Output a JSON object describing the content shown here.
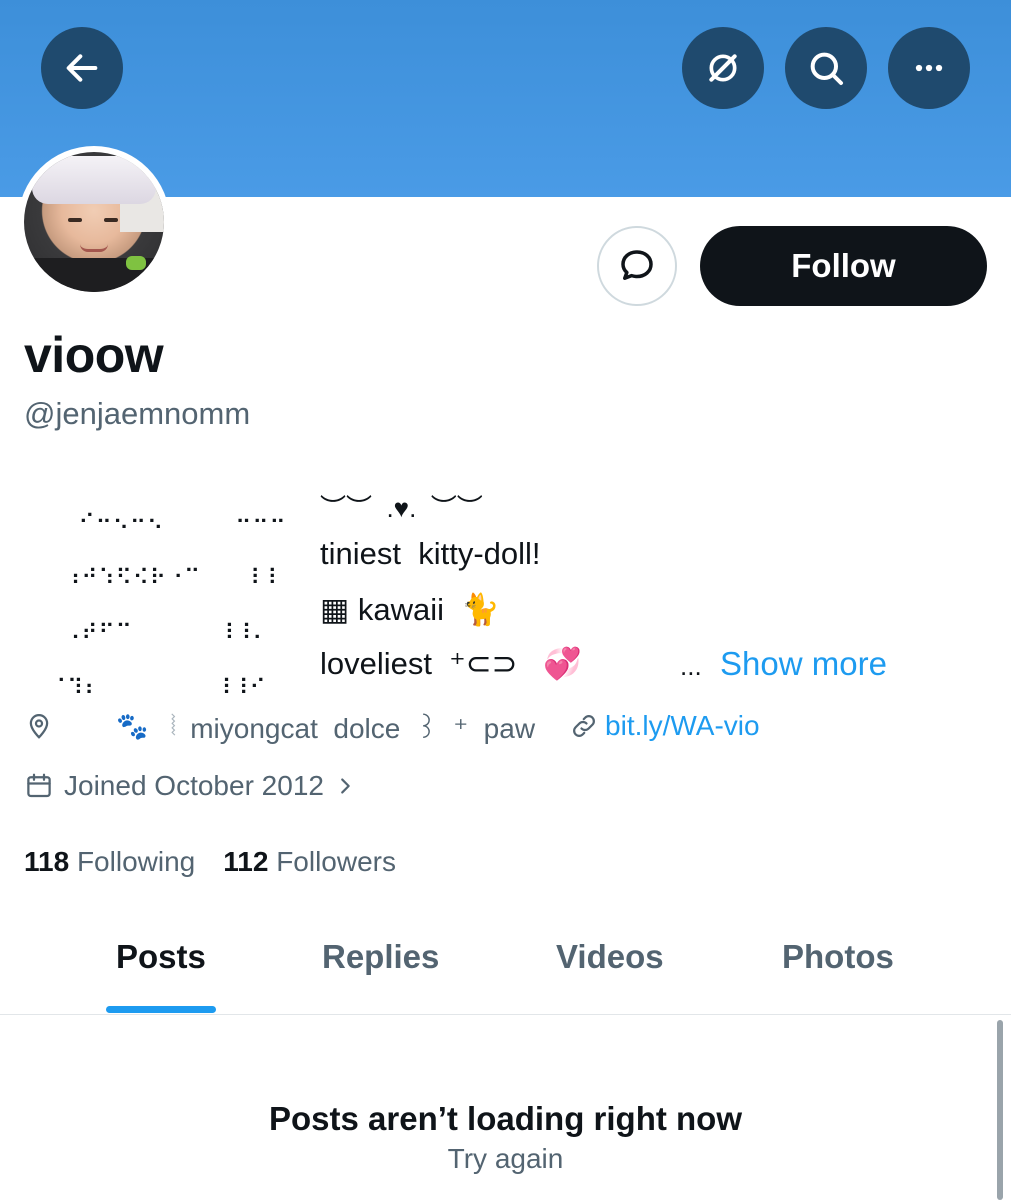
{
  "colors": {
    "banner": "#4a9be6",
    "accent": "#1d9bf0",
    "text_primary": "#0f1419",
    "text_secondary": "#536471",
    "follow_bg": "#0f1419",
    "follow_text": "#ffffff",
    "nav_button_bg": "#1f4a6e"
  },
  "nav": {
    "back_icon": "arrow-left-icon",
    "grok_icon": "slash-circle-icon",
    "search_icon": "search-icon",
    "more_icon": "more-horizontal-icon"
  },
  "profile": {
    "display_name": "vioow",
    "handle": "@jenjaemnomm",
    "follow_label": "Follow",
    "message_icon": "message-bubble-icon"
  },
  "bio": {
    "art": "  ⠊⠒⠢⠒⠢     ⠒⠒⠒\n ⠰⠚⠱⠫⠪⠗⠐⠉   ⠸⠸\n ⠠⠞⠋⠉      ⠸⠸⠄\n⠈⠹⠆        ⠸⠸⠊",
    "top_line": "︶︶  .♥.  ︶︶",
    "line1": "tiniest  kitty-doll!",
    "line2": "▦ kawaii  🐈",
    "line3": "loveliest  ⁺⊂⊃   💞",
    "ellipsis": "...",
    "show_more": "Show more"
  },
  "meta": {
    "location_icon": "map-pin-icon",
    "location_paw": "🐾",
    "location_sep": "⦚",
    "location_text": "miyongcat  dolce  ꒱  ⁺  paw",
    "link_icon": "link-icon",
    "link_text": "bit.ly/WA-vio",
    "calendar_icon": "calendar-icon",
    "joined_text": "Joined October 2012"
  },
  "stats": {
    "following_count": "118",
    "following_label": "Following",
    "followers_count": "112",
    "followers_label": "Followers"
  },
  "tabs": {
    "posts": "Posts",
    "replies": "Replies",
    "videos": "Videos",
    "photos": "Photos",
    "active": "Posts"
  },
  "feed": {
    "error_title": "Posts aren’t loading right now",
    "retry_label": "Try again"
  }
}
